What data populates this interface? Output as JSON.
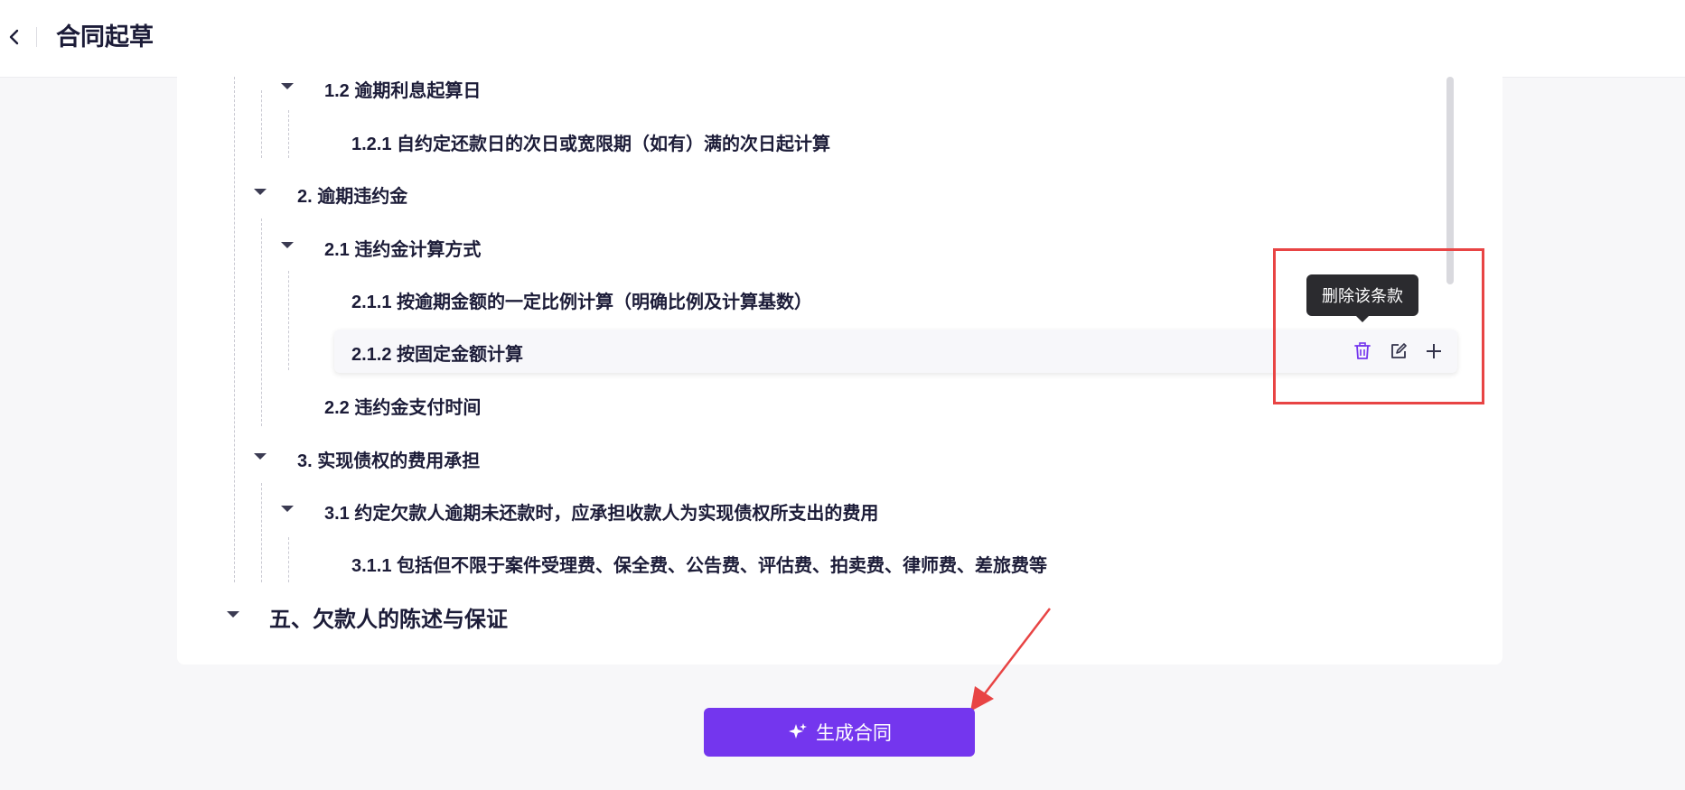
{
  "header": {
    "title": "合同起草"
  },
  "outline": {
    "rows": [
      {
        "text": "1.2 逾期利息起算日"
      },
      {
        "text": "1.2.1 自约定还款日的次日或宽限期（如有）满的次日起计算"
      },
      {
        "text": "2. 逾期违约金"
      },
      {
        "text": "2.1 违约金计算方式"
      },
      {
        "text": "2.1.1 按逾期金额的一定比例计算（明确比例及计算基数）"
      },
      {
        "text": "2.1.2 按固定金额计算"
      },
      {
        "text": "2.2 违约金支付时间"
      },
      {
        "text": "3. 实现债权的费用承担"
      },
      {
        "text": "3.1 约定欠款人逾期未还款时，应承担收款人为实现债权所支出的费用"
      },
      {
        "text": "3.1.1 包括但不限于案件受理费、保全费、公告费、评估费、拍卖费、律师费、差旅费等"
      },
      {
        "text": "五、欠款人的陈述与保证"
      }
    ]
  },
  "row_actions": {
    "tooltip": "删除该条款",
    "delete_icon": "trash-icon",
    "edit_icon": "edit-icon",
    "add_icon": "plus-icon"
  },
  "generate_button": {
    "label": "生成合同",
    "icon": "sparkle-icon"
  },
  "colors": {
    "accent": "#7436ee",
    "annotation_red": "#e84444",
    "tooltip_bg": "#2b2b2f"
  }
}
